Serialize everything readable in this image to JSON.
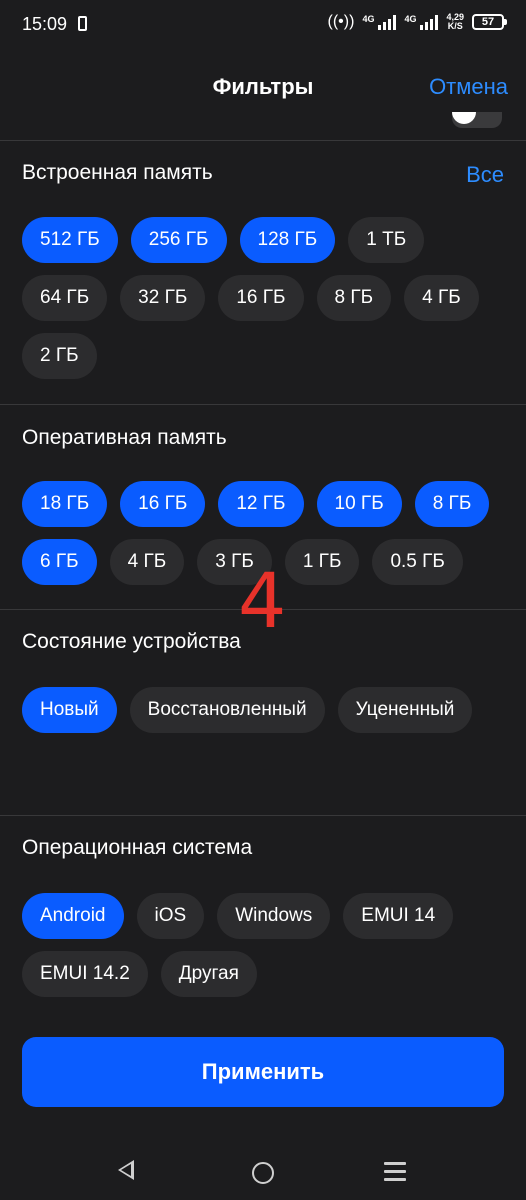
{
  "status": {
    "time": "15:09",
    "net1": "4G",
    "net2": "4G",
    "speed_value": "4,29",
    "speed_unit": "K/S",
    "battery": "57"
  },
  "header": {
    "title": "Фильтры",
    "cancel": "Отмена"
  },
  "storage": {
    "title": "Встроенная память",
    "all_link": "Все",
    "options": [
      {
        "label": "512 ГБ",
        "selected": true
      },
      {
        "label": "256 ГБ",
        "selected": true
      },
      {
        "label": "128 ГБ",
        "selected": true
      },
      {
        "label": "1 ТБ",
        "selected": false
      },
      {
        "label": "64 ГБ",
        "selected": false
      },
      {
        "label": "32 ГБ",
        "selected": false
      },
      {
        "label": "16 ГБ",
        "selected": false
      },
      {
        "label": "8 ГБ",
        "selected": false
      },
      {
        "label": "4 ГБ",
        "selected": false
      },
      {
        "label": "2 ГБ",
        "selected": false
      }
    ]
  },
  "ram": {
    "title": "Оперативная память",
    "options": [
      {
        "label": "18 ГБ",
        "selected": true
      },
      {
        "label": "16 ГБ",
        "selected": true
      },
      {
        "label": "12 ГБ",
        "selected": true
      },
      {
        "label": "10 ГБ",
        "selected": true
      },
      {
        "label": "8 ГБ",
        "selected": true
      },
      {
        "label": "6 ГБ",
        "selected": true
      },
      {
        "label": "4 ГБ",
        "selected": false
      },
      {
        "label": "3 ГБ",
        "selected": false
      },
      {
        "label": "1 ГБ",
        "selected": false
      },
      {
        "label": "0.5 ГБ",
        "selected": false
      }
    ]
  },
  "condition": {
    "title": "Состояние устройства",
    "options": [
      {
        "label": "Новый",
        "selected": true
      },
      {
        "label": "Восстановленный",
        "selected": false
      },
      {
        "label": "Уцененный",
        "selected": false
      }
    ]
  },
  "os": {
    "title": "Операционная система",
    "options": [
      {
        "label": "Android",
        "selected": true
      },
      {
        "label": "iOS",
        "selected": false
      },
      {
        "label": "Windows",
        "selected": false
      },
      {
        "label": "EMUI 14",
        "selected": false
      },
      {
        "label": "EMUI 14.2",
        "selected": false
      },
      {
        "label": "Другая",
        "selected": false
      }
    ]
  },
  "overlay_number": "4",
  "apply_label": "Применить",
  "colors": {
    "background": "#1c1c1e",
    "chip": "#2c2c2e",
    "chip_selected": "#0a5cff",
    "link": "#2d8cff",
    "overlay": "#e8322a"
  }
}
